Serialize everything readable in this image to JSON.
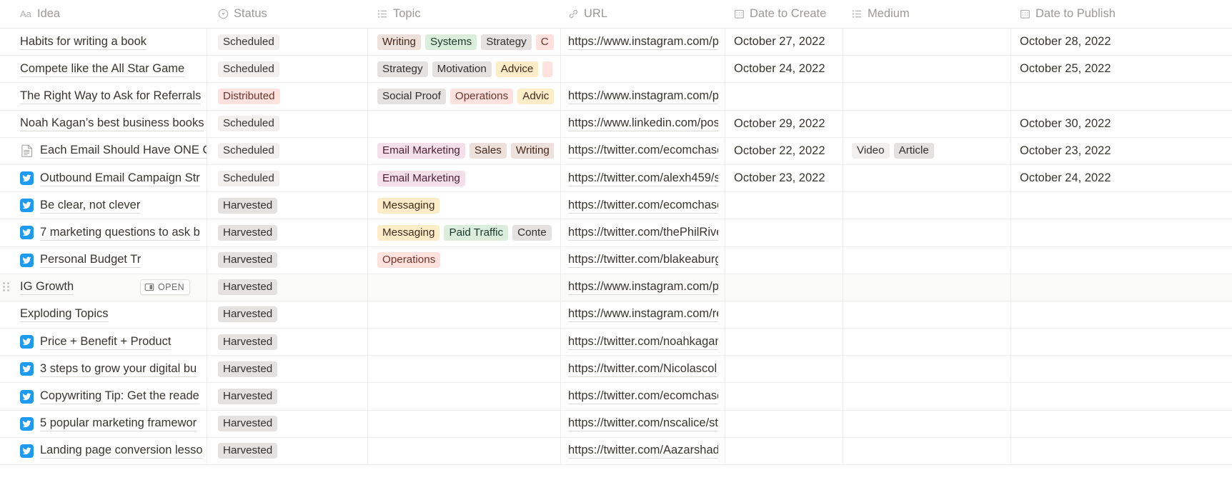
{
  "columns": [
    {
      "key": "idea",
      "label": "Idea",
      "icon": "title-aa-icon"
    },
    {
      "key": "status",
      "label": "Status",
      "icon": "select-circle-icon"
    },
    {
      "key": "topic",
      "label": "Topic",
      "icon": "multi-select-list-icon"
    },
    {
      "key": "url",
      "label": "URL",
      "icon": "link-icon"
    },
    {
      "key": "dcreate",
      "label": "Date to Create",
      "icon": "calendar-icon"
    },
    {
      "key": "medium",
      "label": "Medium",
      "icon": "multi-select-list-icon"
    },
    {
      "key": "dpub",
      "label": "Date to Publish",
      "icon": "calendar-icon"
    }
  ],
  "row_hover": {
    "row_index": 9,
    "open_label": "OPEN",
    "open_icon": "open-panel-icon",
    "drag_handle_icon": "drag-handle-icon"
  },
  "colors": {
    "tag_gray": "#e3e2e0",
    "tag_light_gray": "#f1f0ef",
    "tag_red": "#ffe2dd",
    "tag_pink": "#f5e0e9",
    "tag_brown": "#eee0da",
    "tag_green": "#dbeddb",
    "tag_yellow": "#fdecc8",
    "twitter_blue": "#1d9bf0",
    "text": "#37352f",
    "header_text": "#9b9a97",
    "border": "#eeeeec"
  },
  "rows": [
    {
      "idea": "Habits for writing a book",
      "icon": null,
      "status": {
        "label": "Scheduled",
        "color": "lgray"
      },
      "topic": [
        {
          "label": "Writing",
          "color": "brown"
        },
        {
          "label": "Systems",
          "color": "green"
        },
        {
          "label": "Strategy",
          "color": "gray"
        },
        {
          "label": "C",
          "color": "red"
        }
      ],
      "url": "https://www.instagram.com/p/",
      "dcreate": "October 27, 2022",
      "medium": [],
      "dpub": "October 28, 2022"
    },
    {
      "idea": "Compete like the All Star Game",
      "icon": null,
      "status": {
        "label": "Scheduled",
        "color": "lgray"
      },
      "topic": [
        {
          "label": "Strategy",
          "color": "gray"
        },
        {
          "label": "Motivation",
          "color": "gray"
        },
        {
          "label": "Advice",
          "color": "yellow"
        },
        {
          "label": "",
          "color": "red"
        }
      ],
      "url": "",
      "dcreate": "October 24, 2022",
      "medium": [],
      "dpub": "October 25, 2022"
    },
    {
      "idea": "The Right Way to Ask for Referrals",
      "icon": null,
      "status": {
        "label": "Distributed",
        "color": "red"
      },
      "topic": [
        {
          "label": "Social Proof",
          "color": "gray"
        },
        {
          "label": "Operations",
          "color": "red"
        },
        {
          "label": "Advic",
          "color": "yellow"
        }
      ],
      "url": "https://www.instagram.com/p/",
      "dcreate": "",
      "medium": [],
      "dpub": ""
    },
    {
      "idea": "Noah Kagan’s best business books",
      "icon": null,
      "status": {
        "label": "Scheduled",
        "color": "lgray"
      },
      "topic": [],
      "url": "https://www.linkedin.com/post",
      "dcreate": "October 29, 2022",
      "medium": [],
      "dpub": "October 30, 2022"
    },
    {
      "idea": "Each Email Should Have ONE C",
      "icon": "document-icon",
      "status": {
        "label": "Scheduled",
        "color": "lgray"
      },
      "topic": [
        {
          "label": "Email Marketing",
          "color": "pink"
        },
        {
          "label": "Sales",
          "color": "brown"
        },
        {
          "label": "Writing",
          "color": "brown"
        }
      ],
      "url": "https://twitter.com/ecomchase",
      "dcreate": "October 22, 2022",
      "medium": [
        {
          "label": "Video",
          "color": "lgray"
        },
        {
          "label": "Article",
          "color": "gray"
        }
      ],
      "dpub": "October 23, 2022"
    },
    {
      "idea": "Outbound Email Campaign Str",
      "icon": "twitter-icon",
      "status": {
        "label": "Scheduled",
        "color": "lgray"
      },
      "topic": [
        {
          "label": "Email Marketing",
          "color": "pink"
        }
      ],
      "url": "https://twitter.com/alexh459/s",
      "dcreate": "October 23, 2022",
      "medium": [],
      "dpub": "October 24, 2022"
    },
    {
      "idea": "Be clear, not clever",
      "icon": "twitter-icon",
      "status": {
        "label": "Harvested",
        "color": "gray"
      },
      "topic": [
        {
          "label": "Messaging",
          "color": "yellow"
        }
      ],
      "url": "https://twitter.com/ecomchase",
      "dcreate": "",
      "medium": [],
      "dpub": ""
    },
    {
      "idea": "7 marketing questions to ask b",
      "icon": "twitter-icon",
      "status": {
        "label": "Harvested",
        "color": "gray"
      },
      "topic": [
        {
          "label": "Messaging",
          "color": "yellow"
        },
        {
          "label": "Paid Traffic",
          "color": "green"
        },
        {
          "label": "Conte",
          "color": "gray"
        }
      ],
      "url": "https://twitter.com/thePhilRive",
      "dcreate": "",
      "medium": [],
      "dpub": ""
    },
    {
      "idea": "Personal Budget Tr",
      "icon": "twitter-icon",
      "status": {
        "label": "Harvested",
        "color": "gray"
      },
      "topic": [
        {
          "label": "Operations",
          "color": "red"
        }
      ],
      "url": "https://twitter.com/blakeaburg",
      "dcreate": "",
      "medium": [],
      "dpub": ""
    },
    {
      "idea": "IG Growth",
      "icon": null,
      "status": {
        "label": "Harvested",
        "color": "gray"
      },
      "topic": [],
      "url": "https://www.instagram.com/p/",
      "dcreate": "",
      "medium": [],
      "dpub": ""
    },
    {
      "idea": "Exploding Topics",
      "icon": null,
      "status": {
        "label": "Harvested",
        "color": "gray"
      },
      "topic": [],
      "url": "https://www.instagram.com/re",
      "dcreate": "",
      "medium": [],
      "dpub": ""
    },
    {
      "idea": "Price + Benefit + Product",
      "icon": "twitter-icon",
      "status": {
        "label": "Harvested",
        "color": "gray"
      },
      "topic": [],
      "url": "https://twitter.com/noahkagan",
      "dcreate": "",
      "medium": [],
      "dpub": ""
    },
    {
      "idea": "3 steps to grow your digital bu",
      "icon": "twitter-icon",
      "status": {
        "label": "Harvested",
        "color": "gray"
      },
      "topic": [],
      "url": "https://twitter.com/Nicolascol",
      "dcreate": "",
      "medium": [],
      "dpub": ""
    },
    {
      "idea": "Copywriting Tip: Get the reade",
      "icon": "twitter-icon",
      "status": {
        "label": "Harvested",
        "color": "gray"
      },
      "topic": [],
      "url": "https://twitter.com/ecomchase",
      "dcreate": "",
      "medium": [],
      "dpub": ""
    },
    {
      "idea": "5 popular marketing framewor",
      "icon": "twitter-icon",
      "status": {
        "label": "Harvested",
        "color": "gray"
      },
      "topic": [],
      "url": "https://twitter.com/nscalice/st",
      "dcreate": "",
      "medium": [],
      "dpub": ""
    },
    {
      "idea": "Landing page conversion lesso",
      "icon": "twitter-icon",
      "status": {
        "label": "Harvested",
        "color": "gray"
      },
      "topic": [],
      "url": "https://twitter.com/Aazarshad",
      "dcreate": "",
      "medium": [],
      "dpub": ""
    }
  ]
}
